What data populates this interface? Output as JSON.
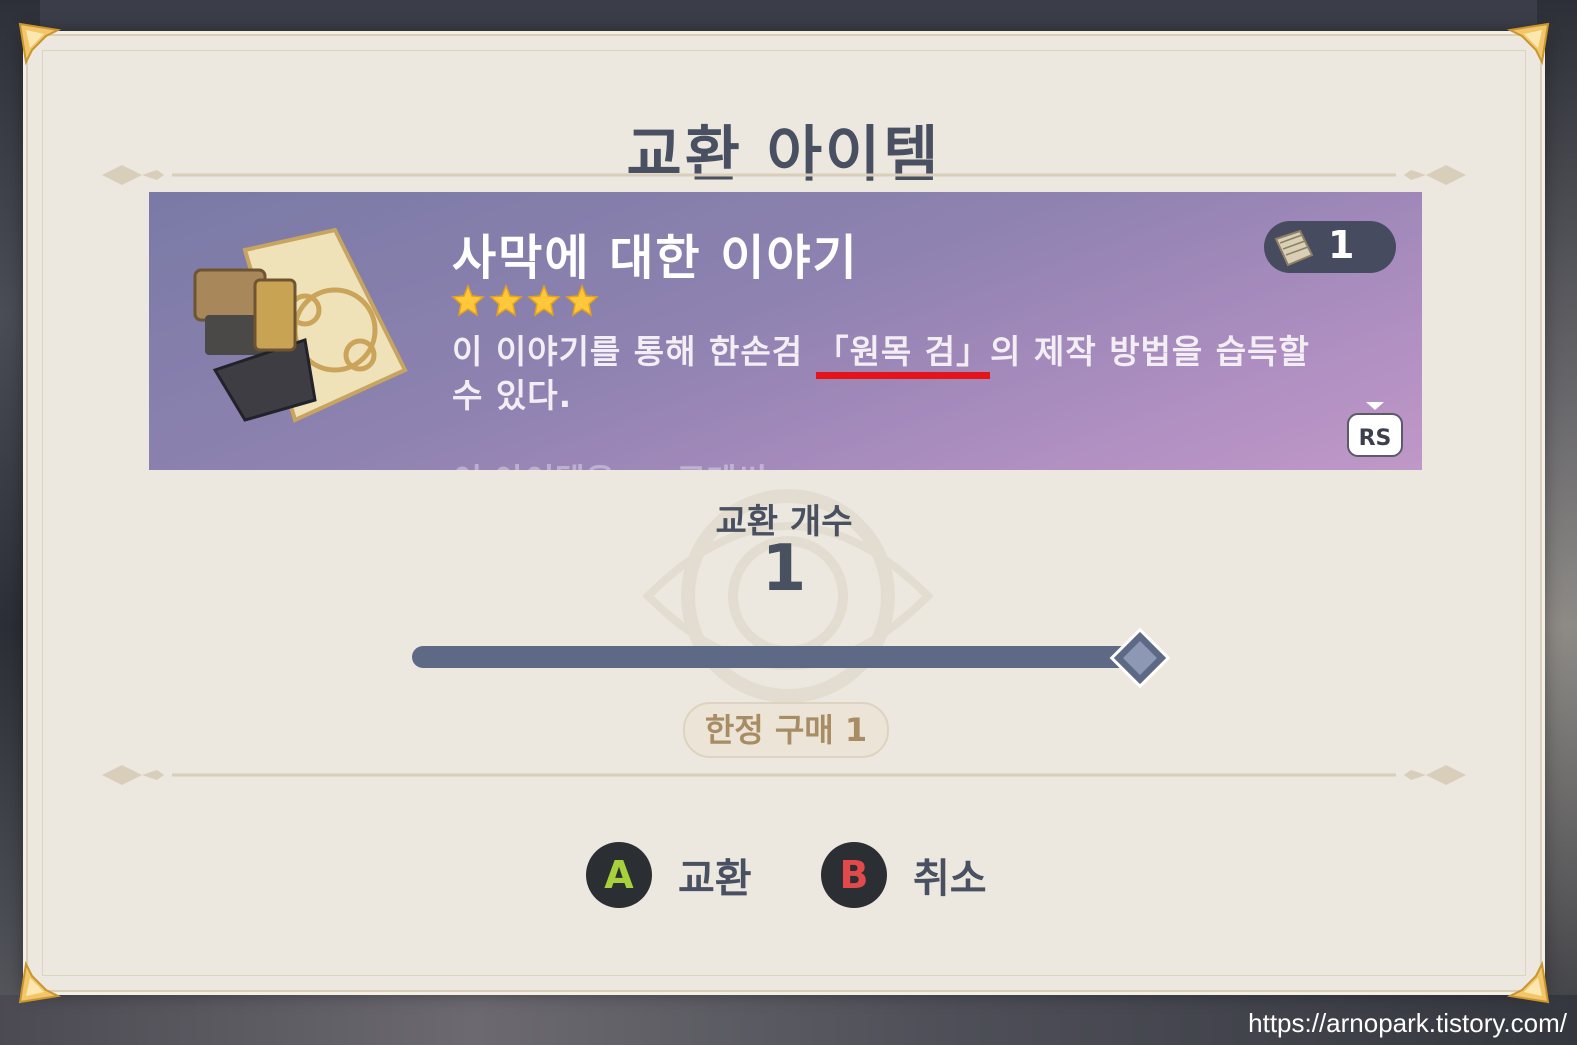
{
  "dialog": {
    "title": "교환 아이템"
  },
  "item": {
    "name": "사막에 대한 이야기",
    "rarity_stars": 4,
    "description_before": "이 이야기를 통해 한손검 ",
    "description_highlight": "「원목 검」",
    "description_after": "의 제작 방법을 습득할 수 있다.",
    "description_faded": "이 아이템은 ... 르메씨...",
    "owned_count": "1",
    "scroll_hint": "RS",
    "highlight_color": "#e5141b"
  },
  "quantity": {
    "label": "교환 개수",
    "value": "1",
    "slider_level": 1.0
  },
  "limit": {
    "label": "한정 구매 1"
  },
  "actions": {
    "confirm_key": "A",
    "confirm_label": "교환",
    "cancel_key": "B",
    "cancel_label": "취소"
  },
  "watermark": "https://arnopark.tistory.com/",
  "colors": {
    "dialog_bg": "#ece8df",
    "card_purple": "#8e82b0",
    "title_text": "#485062",
    "star_gold": "#ffc83a",
    "a_button": "#a7d13c",
    "b_button": "#e2494a"
  }
}
